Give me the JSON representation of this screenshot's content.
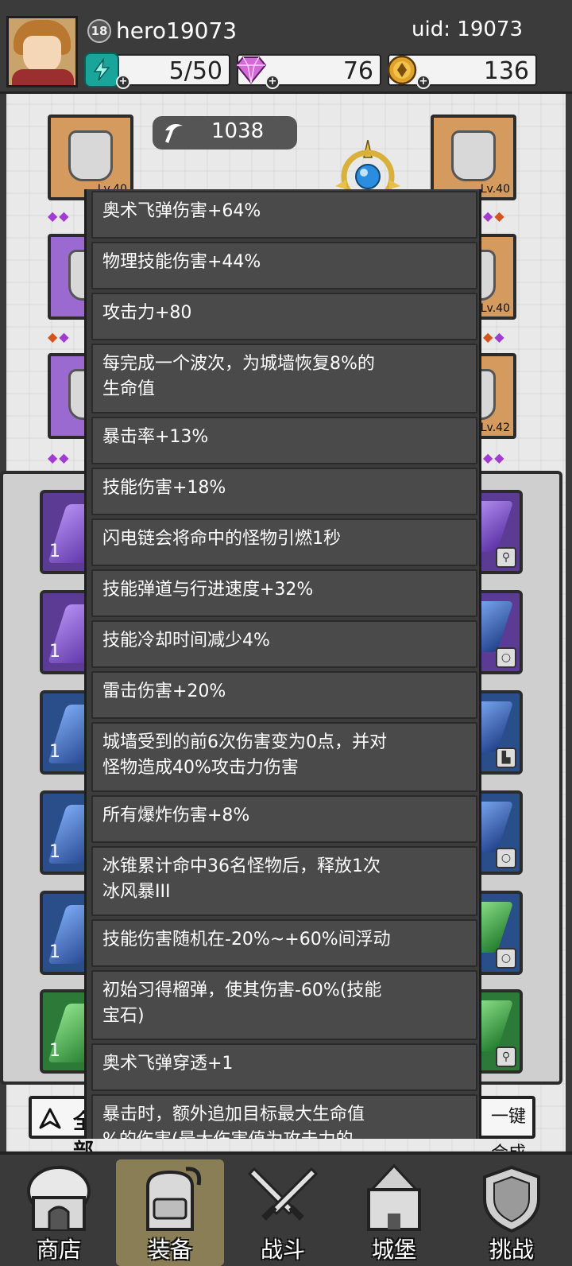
{
  "player": {
    "level": "18",
    "name": "hero19073",
    "uid_text": "uid: 19073"
  },
  "resources": {
    "energy": {
      "icon": "lightning-icon",
      "value": "5/50"
    },
    "gems": {
      "icon": "diamond-icon",
      "value": "76"
    },
    "gold": {
      "icon": "coin-icon",
      "value": "136"
    }
  },
  "equipment": {
    "power": "1038",
    "left_slots": [
      {
        "level": "Lv.40",
        "rarity": "orange"
      },
      {
        "level": "",
        "rarity": "purple"
      },
      {
        "level": "",
        "rarity": "purple"
      }
    ],
    "right_slots": [
      {
        "level": "Lv.40",
        "rarity": "orange"
      },
      {
        "level": "Lv.40",
        "rarity": "orange"
      },
      {
        "level": "Lv.42",
        "rarity": "orange"
      }
    ]
  },
  "inventory": {
    "items": [
      {
        "rarity": "purple",
        "count": "1",
        "type_icon": "staff-icon"
      },
      {
        "rarity": "purple",
        "count": "1",
        "type_icon": "ring-icon"
      },
      {
        "rarity": "blue",
        "count": "1",
        "type_icon": "boot-icon"
      },
      {
        "rarity": "blue",
        "count": "1",
        "type_icon": "ring-icon"
      },
      {
        "rarity": "blue",
        "count": "1",
        "type_icon": "ring-icon"
      },
      {
        "rarity": "green",
        "count": "1",
        "type_icon": "staff-icon"
      }
    ],
    "filter_label": "全部",
    "merge_label": "一键合成"
  },
  "stats": [
    {
      "line1": "奥术飞弹伤害+64%",
      "line2": ""
    },
    {
      "line1": "物理技能伤害+44%",
      "line2": ""
    },
    {
      "line1": "攻击力+80",
      "line2": ""
    },
    {
      "line1": "每完成一个波次，为城墙恢复8%的",
      "line2": "生命值"
    },
    {
      "line1": "暴击率+13%",
      "line2": ""
    },
    {
      "line1": "技能伤害+18%",
      "line2": ""
    },
    {
      "line1": "闪电链会将命中的怪物引燃1秒",
      "line2": ""
    },
    {
      "line1": "技能弹道与行进速度+32%",
      "line2": ""
    },
    {
      "line1": "技能冷却时间减少4%",
      "line2": ""
    },
    {
      "line1": "雷击伤害+20%",
      "line2": ""
    },
    {
      "line1": "城墙受到的前6次伤害变为0点，并对",
      "line2": "怪物造成40%攻击力伤害"
    },
    {
      "line1": "所有爆炸伤害+8%",
      "line2": ""
    },
    {
      "line1": "冰锥累计命中36名怪物后，释放1次",
      "line2": "冰风暴III"
    },
    {
      "line1": "技能伤害随机在-20%~+60%间浮动",
      "line2": ""
    },
    {
      "line1": "初始习得榴弹，使其伤害-60%(技能",
      "line2": "宝石)"
    },
    {
      "line1": "奥术飞弹穿透+1",
      "line2": ""
    },
    {
      "line1": "暴击时，额外追加目标最大生命值",
      "line2": "%的伤害(最大伤害值为攻击力的"
    }
  ],
  "nav": [
    {
      "label": "商店",
      "icon": "shop-icon",
      "active": false
    },
    {
      "label": "装备",
      "icon": "backpack-icon",
      "active": true
    },
    {
      "label": "战斗",
      "icon": "crossed-swords-icon",
      "active": false
    },
    {
      "label": "城堡",
      "icon": "castle-icon",
      "active": false
    },
    {
      "label": "挑战",
      "icon": "shield-icon",
      "active": false
    }
  ],
  "colors": {
    "purple_rarity": "#5b3b94",
    "blue_rarity": "#2a4e8a",
    "green_rarity": "#2d7a38",
    "orange_rarity": "#d49a5e",
    "active_tab": "#8a7e57"
  }
}
